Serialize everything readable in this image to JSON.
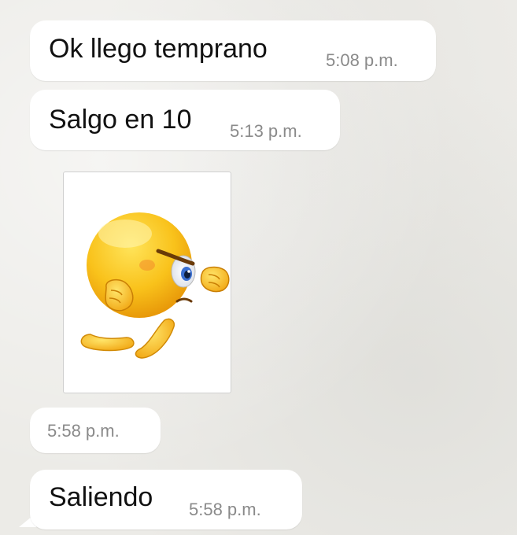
{
  "messages": [
    {
      "text": "Ok llego temprano",
      "time": "5:08 p.m."
    },
    {
      "text": "Salgo en 10",
      "time": "5:13 p.m."
    },
    {
      "sticker": "angry-punching-emoji",
      "time": "5:58 p.m."
    },
    {
      "text": "Saliendo",
      "time": "5:58 p.m."
    }
  ],
  "colors": {
    "bubble": "#ffffff",
    "background": "#ecebe7",
    "time_text": "#8a8a8a",
    "emoji_yellow": "#f7b614"
  }
}
